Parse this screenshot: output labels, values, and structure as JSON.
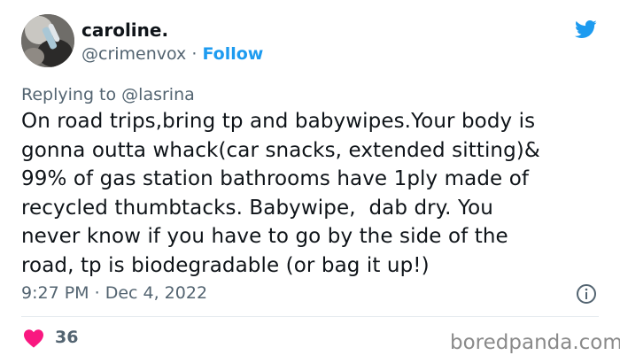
{
  "author": {
    "display_name": "caroline.",
    "handle": "@crimenvox",
    "separator": "·",
    "follow_label": "Follow"
  },
  "reply": {
    "prefix": "Replying to",
    "to_handle": "@lasrina"
  },
  "tweet": {
    "lines": [
      "On road trips,bring tp and babywipes.Your body is",
      "gonna outta whack(car snacks, extended sitting)&",
      "99% of gas station bathrooms have 1ply made of",
      "recycled thumbtacks. Babywipe,  dab dry. You",
      "never know if you have to go by the side of the",
      "road, tp is biodegradable (or bag it up!)"
    ]
  },
  "meta": {
    "time": "9:27 PM",
    "dot": "·",
    "date": "Dec 4, 2022"
  },
  "engagement": {
    "like_count": "36"
  },
  "watermark": "boredpanda.com",
  "colors": {
    "accent": "#1d9bf0",
    "like": "#f91880",
    "secondary_text": "#536471"
  },
  "icons": {
    "brand": "twitter-bird-icon",
    "info": "info-icon",
    "like": "heart-icon"
  }
}
